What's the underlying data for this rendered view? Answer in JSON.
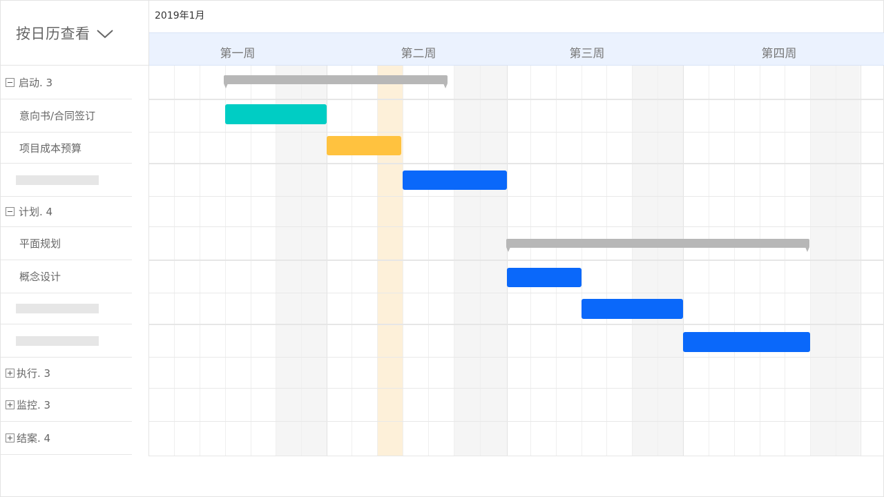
{
  "view_selector": {
    "label": "按日历查看",
    "icon": "chevron-down-icon"
  },
  "timeline": {
    "month": "2019年1月",
    "weeks": [
      "第一周",
      "第二周",
      "第三周",
      "第四周"
    ]
  },
  "tasks": [
    {
      "type": "group",
      "label": "启动. 3",
      "expanded": true
    },
    {
      "type": "task",
      "label": "意向书/合同签订"
    },
    {
      "type": "task",
      "label": "项目成本预算"
    },
    {
      "type": "placeholder"
    },
    {
      "type": "group",
      "label": "计划. 4",
      "expanded": true
    },
    {
      "type": "task",
      "label": "平面规划"
    },
    {
      "type": "task",
      "label": "概念设计"
    },
    {
      "type": "placeholder"
    },
    {
      "type": "placeholder"
    },
    {
      "type": "group",
      "label": "执行. 3",
      "expanded": false
    },
    {
      "type": "group",
      "label": "监控. 3",
      "expanded": false
    },
    {
      "type": "group",
      "label": "结案. 4",
      "expanded": false
    }
  ],
  "colors": {
    "green": "#00cdc4",
    "yellow": "#ffc23f",
    "blue": "#0a68fa",
    "summary": "#b7b7b7",
    "today": "#fdf0d9",
    "header_bg": "#ebf2fe"
  }
}
